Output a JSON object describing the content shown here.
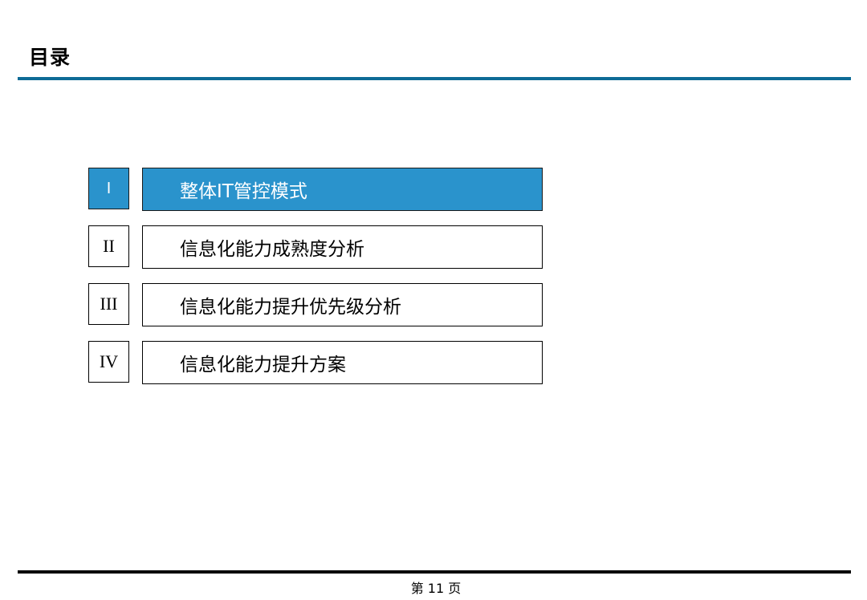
{
  "header": {
    "title": "目录"
  },
  "toc": {
    "items": [
      {
        "number": "I",
        "label": "整体IT管控模式",
        "active": true
      },
      {
        "number": "II",
        "label": "信息化能力成熟度分析",
        "active": false
      },
      {
        "number": "III",
        "label": "信息化能力提升优先级分析",
        "active": false
      },
      {
        "number": "IV",
        "label": "信息化能力提升方案",
        "active": false
      }
    ]
  },
  "footer": {
    "page_number": "第 11 页"
  },
  "colors": {
    "accent_rule": "#0e6b96",
    "active_fill": "#2a93cc",
    "footer_rule": "#000000"
  }
}
